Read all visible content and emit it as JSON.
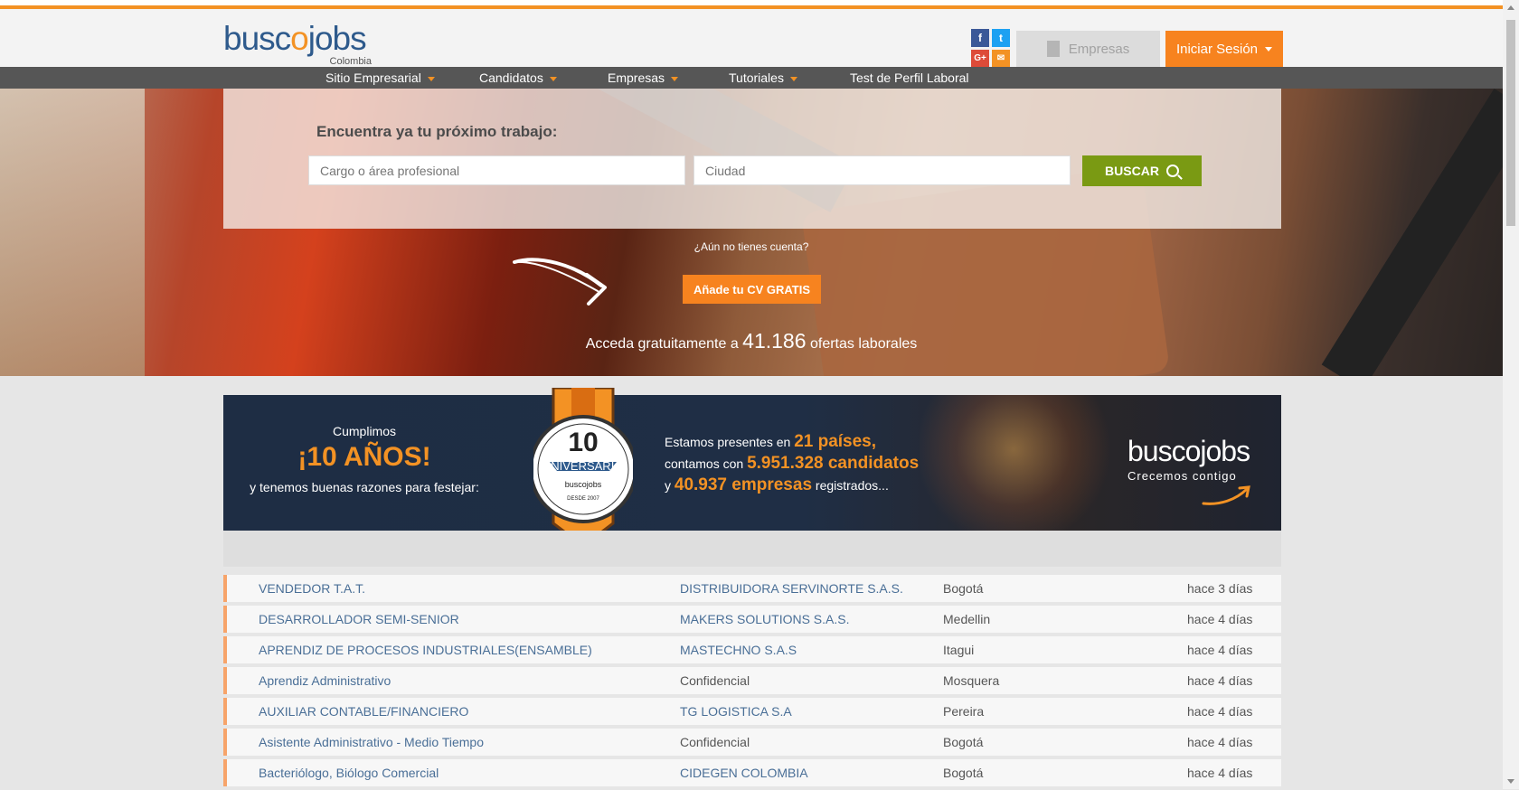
{
  "header": {
    "logo_main_a": "busc",
    "logo_main_b": "o",
    "logo_main_c": "j",
    "logo_main_d": "obs",
    "logo_country": "Colombia",
    "social": {
      "facebook": "f",
      "twitter": "t",
      "googleplus": "G+",
      "email": "✉"
    },
    "empresas_label": "Empresas",
    "login_label": "Iniciar Sesión"
  },
  "nav": [
    {
      "label": "Sitio Empresarial",
      "dropdown": true
    },
    {
      "label": "Candidatos",
      "dropdown": true
    },
    {
      "label": "Empresas",
      "dropdown": true
    },
    {
      "label": "Tutoriales",
      "dropdown": true
    },
    {
      "label": "Test de Perfil Laboral",
      "dropdown": false
    }
  ],
  "search": {
    "title": "Encuentra ya tu próximo trabajo:",
    "cargo_placeholder": "Cargo o área profesional",
    "ciudad_placeholder": "Ciudad",
    "button_label": "BUSCAR"
  },
  "hero": {
    "no_account": "¿Aún no tienes cuenta?",
    "cv_button": "Añade tu CV GRATIS",
    "offers_prefix": "Acceda gratuitamente a",
    "offers_count": "41.186",
    "offers_suffix": "ofertas laborales"
  },
  "banner": {
    "cumplimos": "Cumplimos",
    "anos": "¡10 AÑOS!",
    "razones": "y tenemos buenas razones para festejar:",
    "medal_number": "10",
    "medal_label": "ANIVERSARIO",
    "medal_brand": "buscojobs",
    "medal_since": "DESDE 2007",
    "line1_prefix": "Estamos presentes en",
    "line1_hl": "21 países,",
    "line2_prefix": "contamos con",
    "line2_hl": "5.951.328 candidatos",
    "line3_prefix": "y",
    "line3_hl": "40.937 empresas",
    "line3_suffix": "registrados...",
    "logo": "buscojobs",
    "slogan": "Crecemos contigo"
  },
  "jobs": [
    {
      "title": "VENDEDOR T.A.T.",
      "company": "DISTRIBUIDORA SERVINORTE S.A.S.",
      "city": "Bogotá",
      "date": "hace 3 días"
    },
    {
      "title": "DESARROLLADOR SEMI-SENIOR",
      "company": "MAKERS SOLUTIONS S.A.S.",
      "city": "Medellin",
      "date": "hace 4 días"
    },
    {
      "title": "APRENDIZ DE PROCESOS INDUSTRIALES(ENSAMBLE)",
      "company": "MASTECHNO S.A.S",
      "city": "Itagui",
      "date": "hace 4 días"
    },
    {
      "title": "Aprendiz Administrativo",
      "company": "Confidencial",
      "city": "Mosquera",
      "date": "hace 4 días"
    },
    {
      "title": "AUXILIAR CONTABLE/FINANCIERO",
      "company": "TG LOGISTICA S.A",
      "city": "Pereira",
      "date": "hace 4 días"
    },
    {
      "title": "Asistente Administrativo - Medio Tiempo",
      "company": "Confidencial",
      "city": "Bogotá",
      "date": "hace 4 días"
    },
    {
      "title": "Bacteriólogo, Biólogo Comercial",
      "company": "CIDEGEN COLOMBIA",
      "city": "Bogotá",
      "date": "hace 4 días"
    }
  ],
  "colors": {
    "brand_orange": "#f7831f",
    "brand_blue": "#2e5a8c",
    "search_green": "#7a9a13",
    "nav_gray": "#565656"
  }
}
